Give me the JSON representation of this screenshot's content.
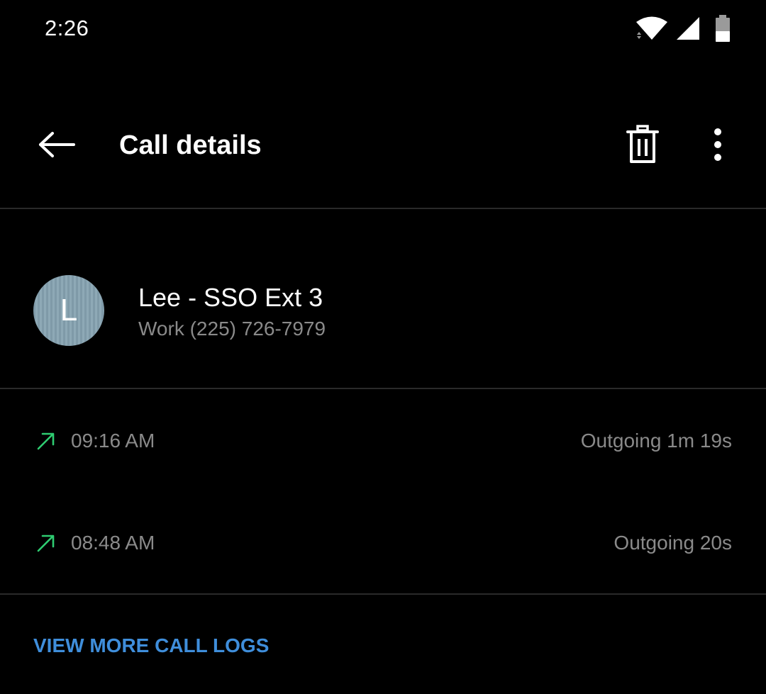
{
  "status_bar": {
    "time": "2:26",
    "icons": [
      "wifi-icon",
      "cell-signal-icon",
      "battery-icon"
    ]
  },
  "app_bar": {
    "title": "Call details",
    "back_icon": "arrow-left-icon",
    "delete_icon": "trash-icon",
    "more_icon": "more-vertical-icon"
  },
  "contact": {
    "avatar_letter": "L",
    "avatar_color": "#8aa4b1",
    "name": "Lee - SSO Ext 3",
    "number": "Work (225) 726-7979"
  },
  "calls": [
    {
      "direction_icon": "outgoing-call-arrow-icon",
      "time": "09:16 AM",
      "detail": "Outgoing 1m 19s"
    },
    {
      "direction_icon": "outgoing-call-arrow-icon",
      "time": "08:48 AM",
      "detail": "Outgoing 20s"
    }
  ],
  "footer": {
    "view_more_label": "VIEW MORE CALL LOGS"
  },
  "colors": {
    "background": "#000000",
    "primary_text": "#ffffff",
    "secondary_text": "#8a8a8a",
    "accent": "#3f8edb",
    "outgoing_arrow": "#2ecc71",
    "divider": "#2a2a2a"
  }
}
